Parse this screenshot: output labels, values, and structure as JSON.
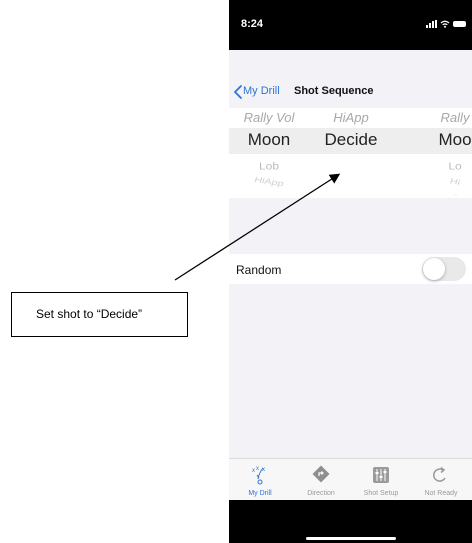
{
  "status_bar": {
    "time": "8:24"
  },
  "nav": {
    "back_label": "My Drill",
    "title": "Shot Sequence"
  },
  "picker": {
    "columns": [
      {
        "above": "Rally Vol",
        "selected": "Moon",
        "below": [
          "Lob",
          "HiApp",
          ""
        ]
      },
      {
        "above": "HiApp",
        "selected": "Decide",
        "below": [
          "",
          "",
          ""
        ]
      },
      {
        "above": "Rally",
        "selected": "Moo",
        "below": [
          "Lo",
          "Hi",
          "~"
        ]
      }
    ]
  },
  "random": {
    "label": "Random",
    "enabled": false
  },
  "tab_bar": {
    "tabs": [
      {
        "label": "My Drill",
        "icon": "play-diagram-icon",
        "active": true
      },
      {
        "label": "Direction",
        "icon": "direction-sign-icon",
        "active": false
      },
      {
        "label": "Shot Setup",
        "icon": "sliders-icon",
        "active": false
      },
      {
        "label": "Not Ready",
        "icon": "refresh-icon",
        "active": false
      }
    ]
  },
  "annotation": {
    "text": "Set shot to “Decide”"
  },
  "colors": {
    "accent": "#2f74d6",
    "status_bar": "#000000",
    "background": "#f2f2f7"
  }
}
